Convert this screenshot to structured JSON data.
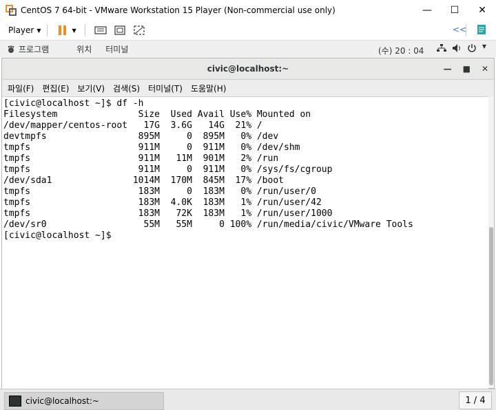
{
  "window": {
    "title": "CentOS 7 64-bit - VMware Workstation 15 Player (Non-commercial use only)",
    "minimize_icon": "minimize-icon",
    "maximize_icon": "maximize-icon",
    "close_icon": "close-icon"
  },
  "vmware_toolbar": {
    "player_label": "Player",
    "pause_color": "#f28c1c"
  },
  "gnome_bar": {
    "applications": "프로그램",
    "places": "위치",
    "terminal": "터미널",
    "clock": "(수) 20 : 04"
  },
  "terminal": {
    "title": "civic@localhost:~",
    "menu": [
      "파일(F)",
      "편집(E)",
      "보기(V)",
      "검색(S)",
      "터미널(T)",
      "도움말(H)"
    ],
    "lines": [
      "[civic@localhost ~]$ df -h",
      "Filesystem               Size  Used Avail Use% Mounted on",
      "/dev/mapper/centos-root   17G  3.6G   14G  21% /",
      "devtmpfs                 895M     0  895M   0% /dev",
      "tmpfs                    911M     0  911M   0% /dev/shm",
      "tmpfs                    911M   11M  901M   2% /run",
      "tmpfs                    911M     0  911M   0% /sys/fs/cgroup",
      "/dev/sda1               1014M  170M  845M  17% /boot",
      "tmpfs                    183M     0  183M   0% /run/user/0",
      "tmpfs                    183M  4.0K  183M   1% /run/user/42",
      "tmpfs                    183M   72K  183M   1% /run/user/1000",
      "/dev/sr0                  55M   55M     0 100% /run/media/civic/VMware Tools",
      "[civic@localhost ~]$ "
    ]
  },
  "taskbar": {
    "item_label": "civic@localhost:~",
    "pager": "1 / 4"
  }
}
